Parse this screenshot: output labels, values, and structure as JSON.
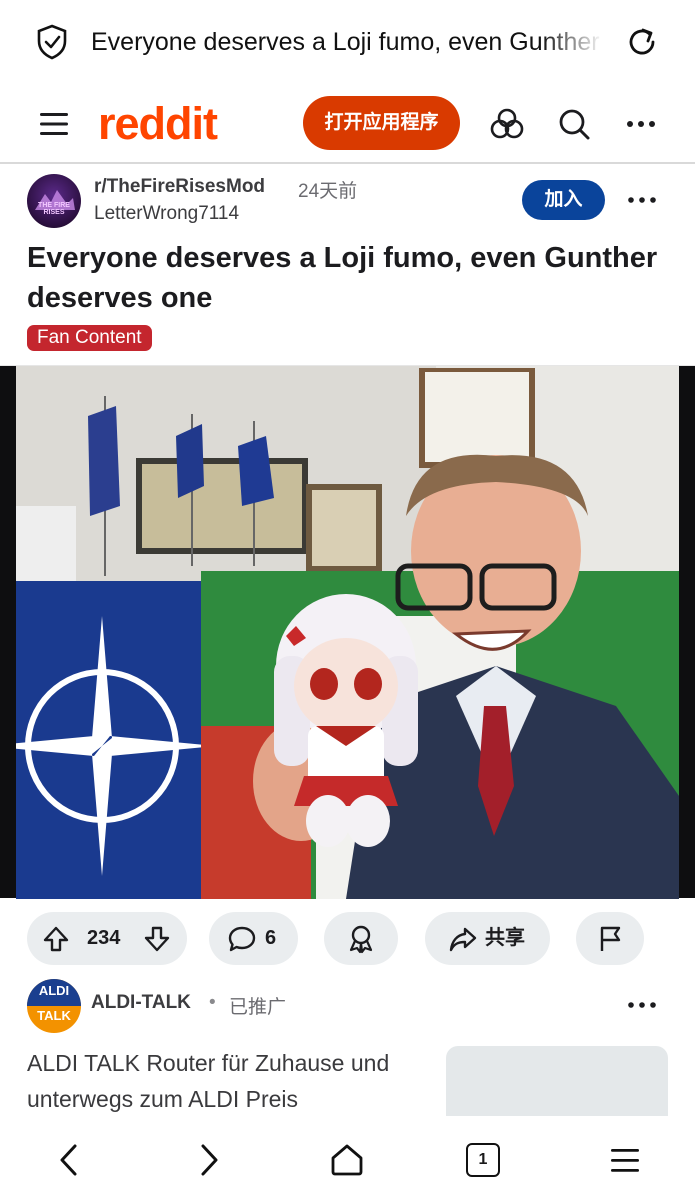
{
  "browser": {
    "page_title": "Everyone deserves a Loji fumo, even Gunther deserves one",
    "icons": [
      "shield-icon",
      "reload-icon"
    ]
  },
  "header": {
    "logo": "reddit",
    "open_app_label": "打开应用程序",
    "icons": [
      "hamburger-menu-icon",
      "communities-icon",
      "search-icon",
      "more-icon"
    ],
    "brand_color": "#ff4500",
    "open_app_color": "#d93a00"
  },
  "post": {
    "subreddit": "r/TheFireRisesMod",
    "age": "24天前",
    "author": "LetterWrong7114",
    "join_label": "加入",
    "title": "Everyone deserves a Loji fumo, even Gunther deserves one",
    "flair": "Fan Content",
    "flair_color": "#c4262e",
    "avatar_text": "THE FIRE RISES",
    "actions": {
      "upvotes": "234",
      "comments": "6",
      "share_label": "共享"
    }
  },
  "ad": {
    "advertiser": "ALDI-TALK",
    "separator": "•",
    "promoted_label": "已推广",
    "logo_top": "ALDI",
    "logo_bottom": "TALK",
    "text": "ALDI TALK Router für Zuhause und unterwegs zum ALDI Preis"
  },
  "toolbar": {
    "tab_count": "1",
    "icons": [
      "back-icon",
      "forward-icon",
      "home-icon",
      "tabs-icon",
      "menu-icon"
    ]
  }
}
